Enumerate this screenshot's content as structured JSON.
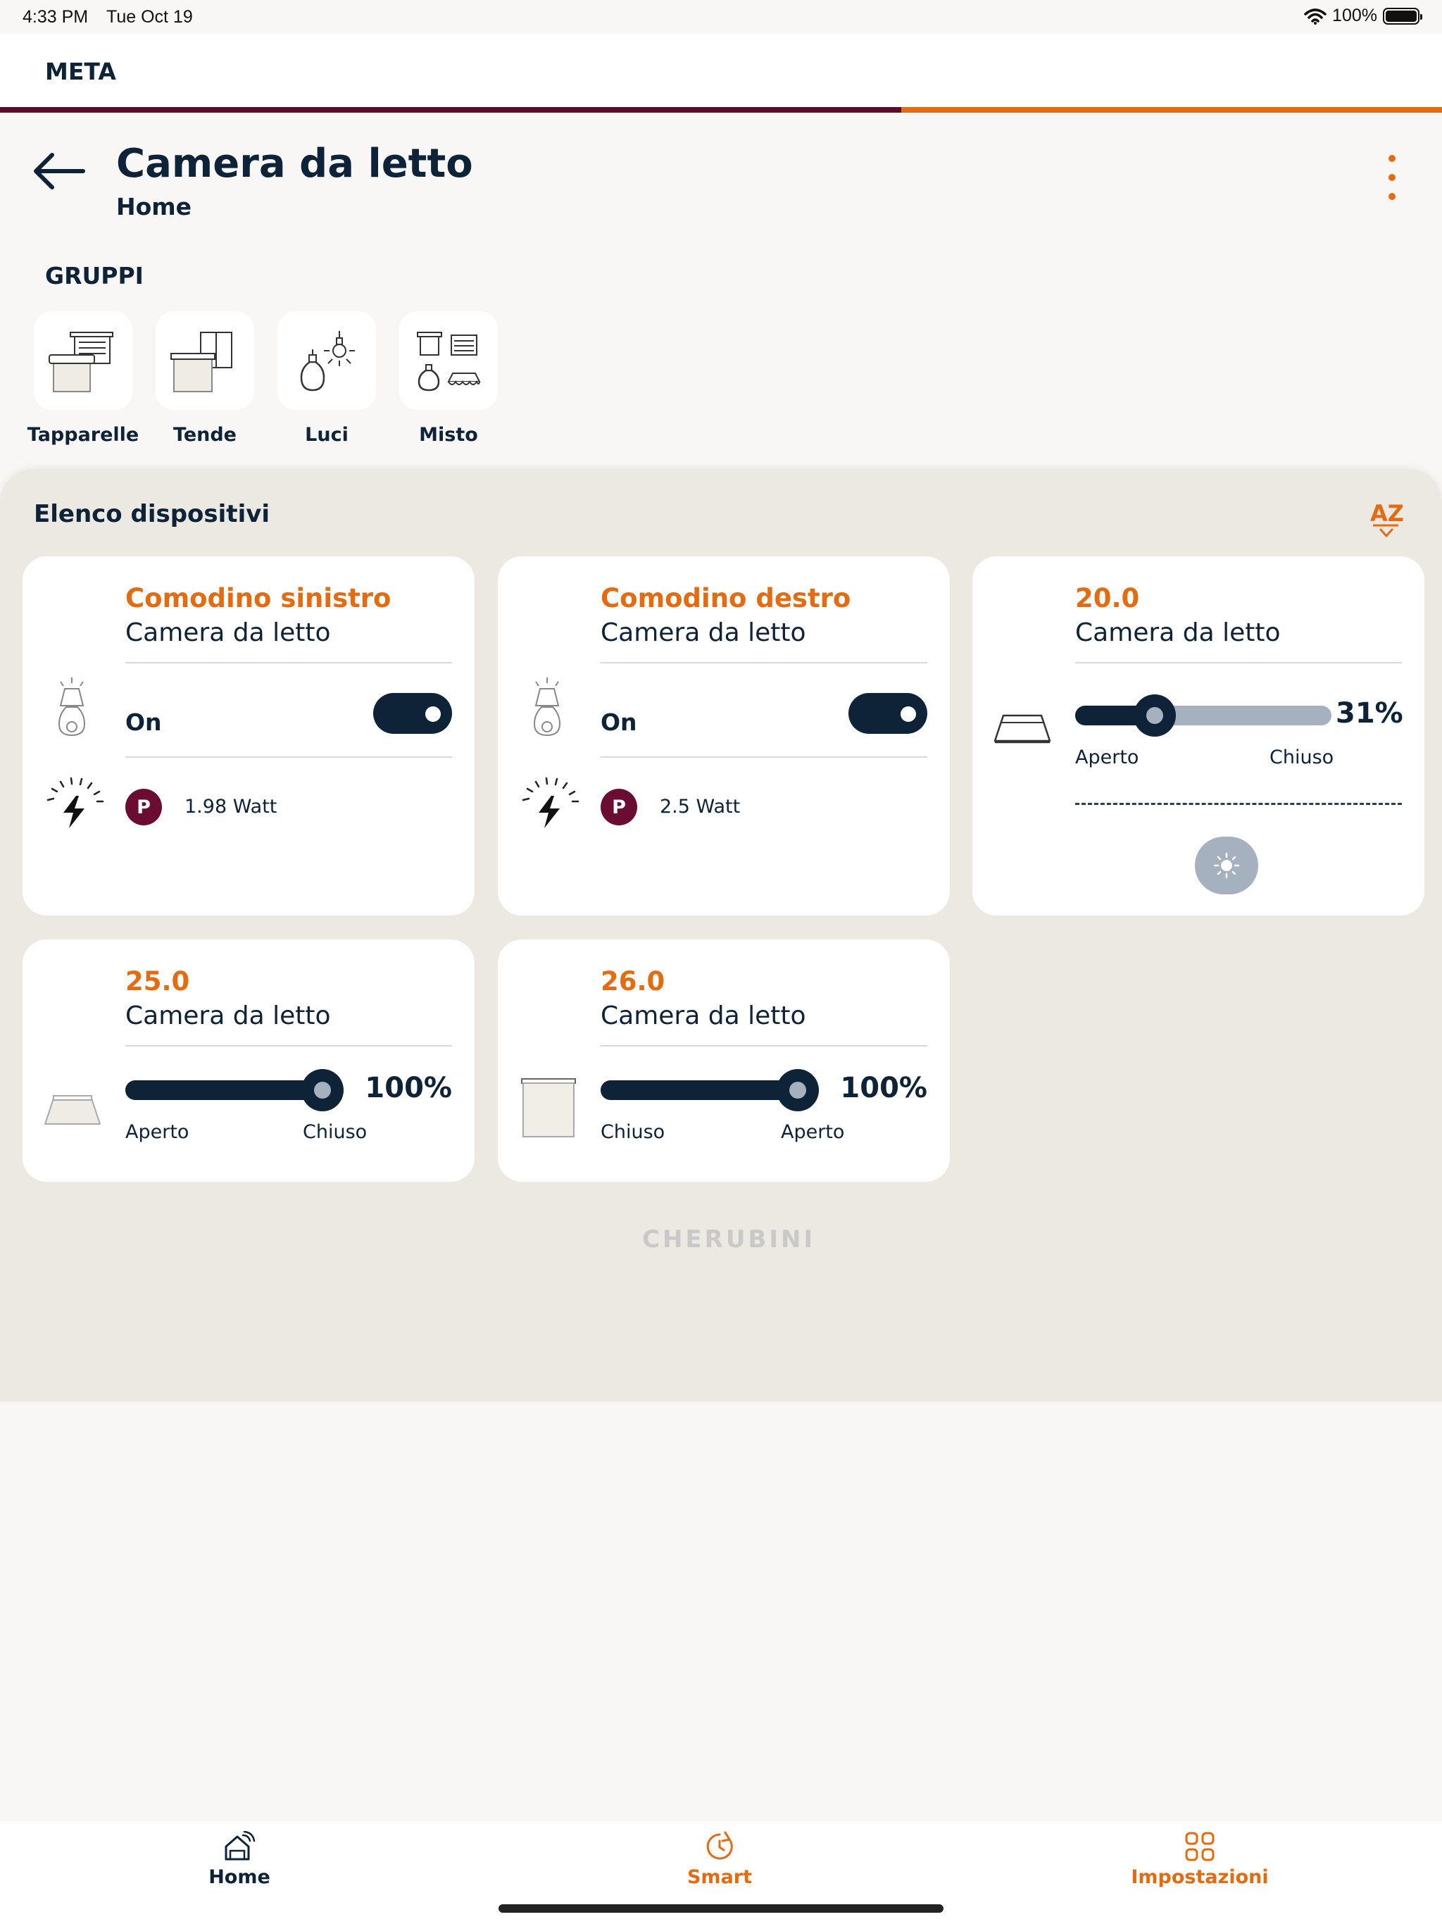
{
  "status_bar": {
    "time": "4:33 PM",
    "date": "Tue Oct 19",
    "battery": "100%"
  },
  "app": {
    "title": "META",
    "progress_fraction": 0.625
  },
  "header": {
    "title": "Camera da letto",
    "subtitle": "Home"
  },
  "groups": {
    "title": "GRUPPI",
    "items": [
      {
        "label": "Tapparelle",
        "icon": "shutter-group-icon"
      },
      {
        "label": "Tende",
        "icon": "curtain-group-icon"
      },
      {
        "label": "Luci",
        "icon": "lights-group-icon"
      },
      {
        "label": "Misto",
        "icon": "mixed-group-icon"
      }
    ]
  },
  "devices": {
    "title": "Elenco dispositivi",
    "sort_icon_text": "AZ",
    "cards": [
      {
        "name": "Comodino sinistro",
        "room": "Camera da letto",
        "state": "On",
        "power_badge": "P",
        "power": "1.98 Watt"
      },
      {
        "name": "Comodino destro",
        "room": "Camera da letto",
        "state": "On",
        "power_badge": "P",
        "power": "2.5 Watt"
      },
      {
        "name": "20.0",
        "room": "Camera da letto",
        "percent": "31%",
        "level": 0.31,
        "left_label": "Aperto",
        "right_label": "Chiuso"
      },
      {
        "name": "25.0",
        "room": "Camera da letto",
        "percent": "100%",
        "level": 1.0,
        "left_label": "Aperto",
        "right_label": "Chiuso"
      },
      {
        "name": "26.0",
        "room": "Camera da letto",
        "percent": "100%",
        "level": 1.0,
        "left_label": "Chiuso",
        "right_label": "Aperto"
      }
    ]
  },
  "brand": "CHERUBINI",
  "tabs": [
    {
      "label": "Home",
      "color": "#0e2238"
    },
    {
      "label": "Smart",
      "color": "#e36b12"
    },
    {
      "label": "Impostazioni",
      "color": "#e36b12"
    }
  ],
  "colors": {
    "accent": "#e36b12",
    "navy": "#0e2238",
    "maroon": "#6b0d33",
    "slider_track": "#a5b1bf"
  }
}
